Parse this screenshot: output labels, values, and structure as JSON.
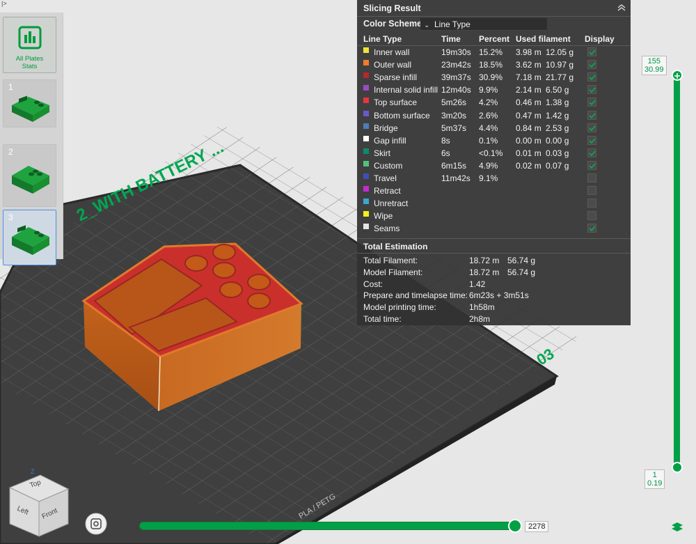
{
  "top_corner_label": "|>",
  "plates": {
    "stats_label": "All Plates\nStats",
    "items": [
      {
        "number": "1"
      },
      {
        "number": "2"
      },
      {
        "number": "3"
      }
    ]
  },
  "build_plate": {
    "plate_text": "2_WITH BATTERY ...",
    "plate_number": "03",
    "plate_material": "PLA / PETG"
  },
  "view_cube": {
    "top": "Top",
    "left": "Left",
    "front": "Front",
    "axis_z": "Z"
  },
  "slicing_result": {
    "title": "Slicing Result",
    "color_scheme_label": "Color Scheme",
    "color_scheme_value": "Line Type",
    "headers": {
      "line_type": "Line Type",
      "time": "Time",
      "percent": "Percent",
      "used_filament": "Used filament",
      "display": "Display"
    },
    "rows": [
      {
        "name": "Inner wall",
        "color": "#f2e33a",
        "time": "19m30s",
        "percent": "15.2%",
        "length": "3.98 m",
        "weight": "12.05 g",
        "display": true
      },
      {
        "name": "Outer wall",
        "color": "#f07c2a",
        "time": "23m42s",
        "percent": "18.5%",
        "length": "3.62 m",
        "weight": "10.97 g",
        "display": true
      },
      {
        "name": "Sparse infill",
        "color": "#b5282e",
        "time": "39m37s",
        "percent": "30.9%",
        "length": "7.18 m",
        "weight": "21.77 g",
        "display": true
      },
      {
        "name": "Internal solid infill",
        "color": "#9a4bc0",
        "time": "12m40s",
        "percent": "9.9%",
        "length": "2.14 m",
        "weight": "6.50 g",
        "display": true
      },
      {
        "name": "Top surface",
        "color": "#e8353d",
        "time": "5m26s",
        "percent": "4.2%",
        "length": "0.46 m",
        "weight": "1.38 g",
        "display": true
      },
      {
        "name": "Bottom surface",
        "color": "#6a5ac8",
        "time": "3m20s",
        "percent": "2.6%",
        "length": "0.47 m",
        "weight": "1.42 g",
        "display": true
      },
      {
        "name": "Bridge",
        "color": "#4f7db7",
        "time": "5m37s",
        "percent": "4.4%",
        "length": "0.84 m",
        "weight": "2.53 g",
        "display": true
      },
      {
        "name": "Gap infill",
        "color": "#ffffff",
        "time": "8s",
        "percent": "0.1%",
        "length": "0.00 m",
        "weight": "0.00 g",
        "display": true
      },
      {
        "name": "Skirt",
        "color": "#0e8a6a",
        "time": "6s",
        "percent": "<0.1%",
        "length": "0.01 m",
        "weight": "0.03 g",
        "display": true
      },
      {
        "name": "Custom",
        "color": "#52c27a",
        "time": "6m15s",
        "percent": "4.9%",
        "length": "0.02 m",
        "weight": "0.07 g",
        "display": true
      },
      {
        "name": "Travel",
        "color": "#3f4fb8",
        "time": "11m42s",
        "percent": "9.1%",
        "length": "",
        "weight": "",
        "display": false
      },
      {
        "name": "Retract",
        "color": "#c42ad0",
        "time": "",
        "percent": "",
        "length": "",
        "weight": "",
        "display": false
      },
      {
        "name": "Unretract",
        "color": "#3aa7cf",
        "time": "",
        "percent": "",
        "length": "",
        "weight": "",
        "display": false
      },
      {
        "name": "Wipe",
        "color": "#f4f01a",
        "time": "",
        "percent": "",
        "length": "",
        "weight": "",
        "display": false
      },
      {
        "name": "Seams",
        "color": "#e4e4e4",
        "time": "",
        "percent": "",
        "length": "",
        "weight": "",
        "display": true
      }
    ],
    "total_estimation": {
      "title": "Total Estimation",
      "rows": [
        {
          "label": "Total Filament:",
          "value": "18.72 m",
          "value2": "56.74 g"
        },
        {
          "label": "Model Filament:",
          "value": "18.72 m",
          "value2": "56.74 g"
        },
        {
          "label": "Cost:",
          "value": "1.42",
          "value2": ""
        },
        {
          "label": "Prepare and timelapse time:",
          "value": "6m23s + 3m51s",
          "value2": ""
        },
        {
          "label": "Model printing time:",
          "value": "1h58m",
          "value2": ""
        },
        {
          "label": "Total time:",
          "value": "2h8m",
          "value2": ""
        }
      ]
    }
  },
  "layer_slider": {
    "top_layer": "155",
    "top_height": "30.99",
    "bottom_layer": "1",
    "bottom_height": "0.19"
  },
  "move_slider": {
    "value": "2278"
  }
}
